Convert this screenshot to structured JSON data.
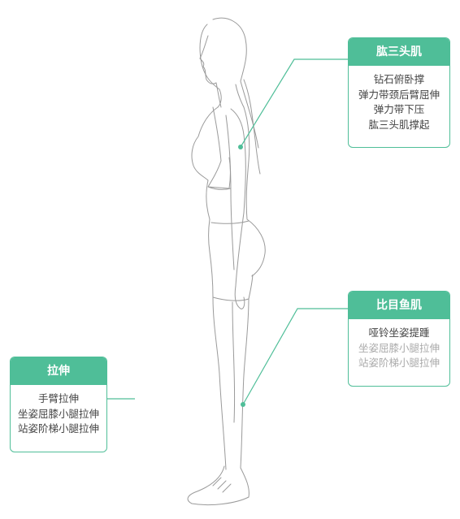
{
  "accent_color": "#4fbe98",
  "line_color": "#9a9a9a",
  "cards": {
    "triceps": {
      "title": "肱三头肌",
      "items": [
        "钻石俯卧撑",
        "弹力带颈后臂屈伸",
        "弹力带下压",
        "肱三头肌撑起"
      ]
    },
    "calf": {
      "title": "比目鱼肌",
      "items": [
        "哑铃坐姿提踵",
        "坐姿屈膝小腿拉伸",
        "站姿阶梯小腿拉伸"
      ]
    },
    "stretch": {
      "title": "拉伸",
      "items": [
        "手臂拉伸",
        "坐姿屈膝小腿拉伸",
        "站姿阶梯小腿拉伸"
      ]
    }
  }
}
